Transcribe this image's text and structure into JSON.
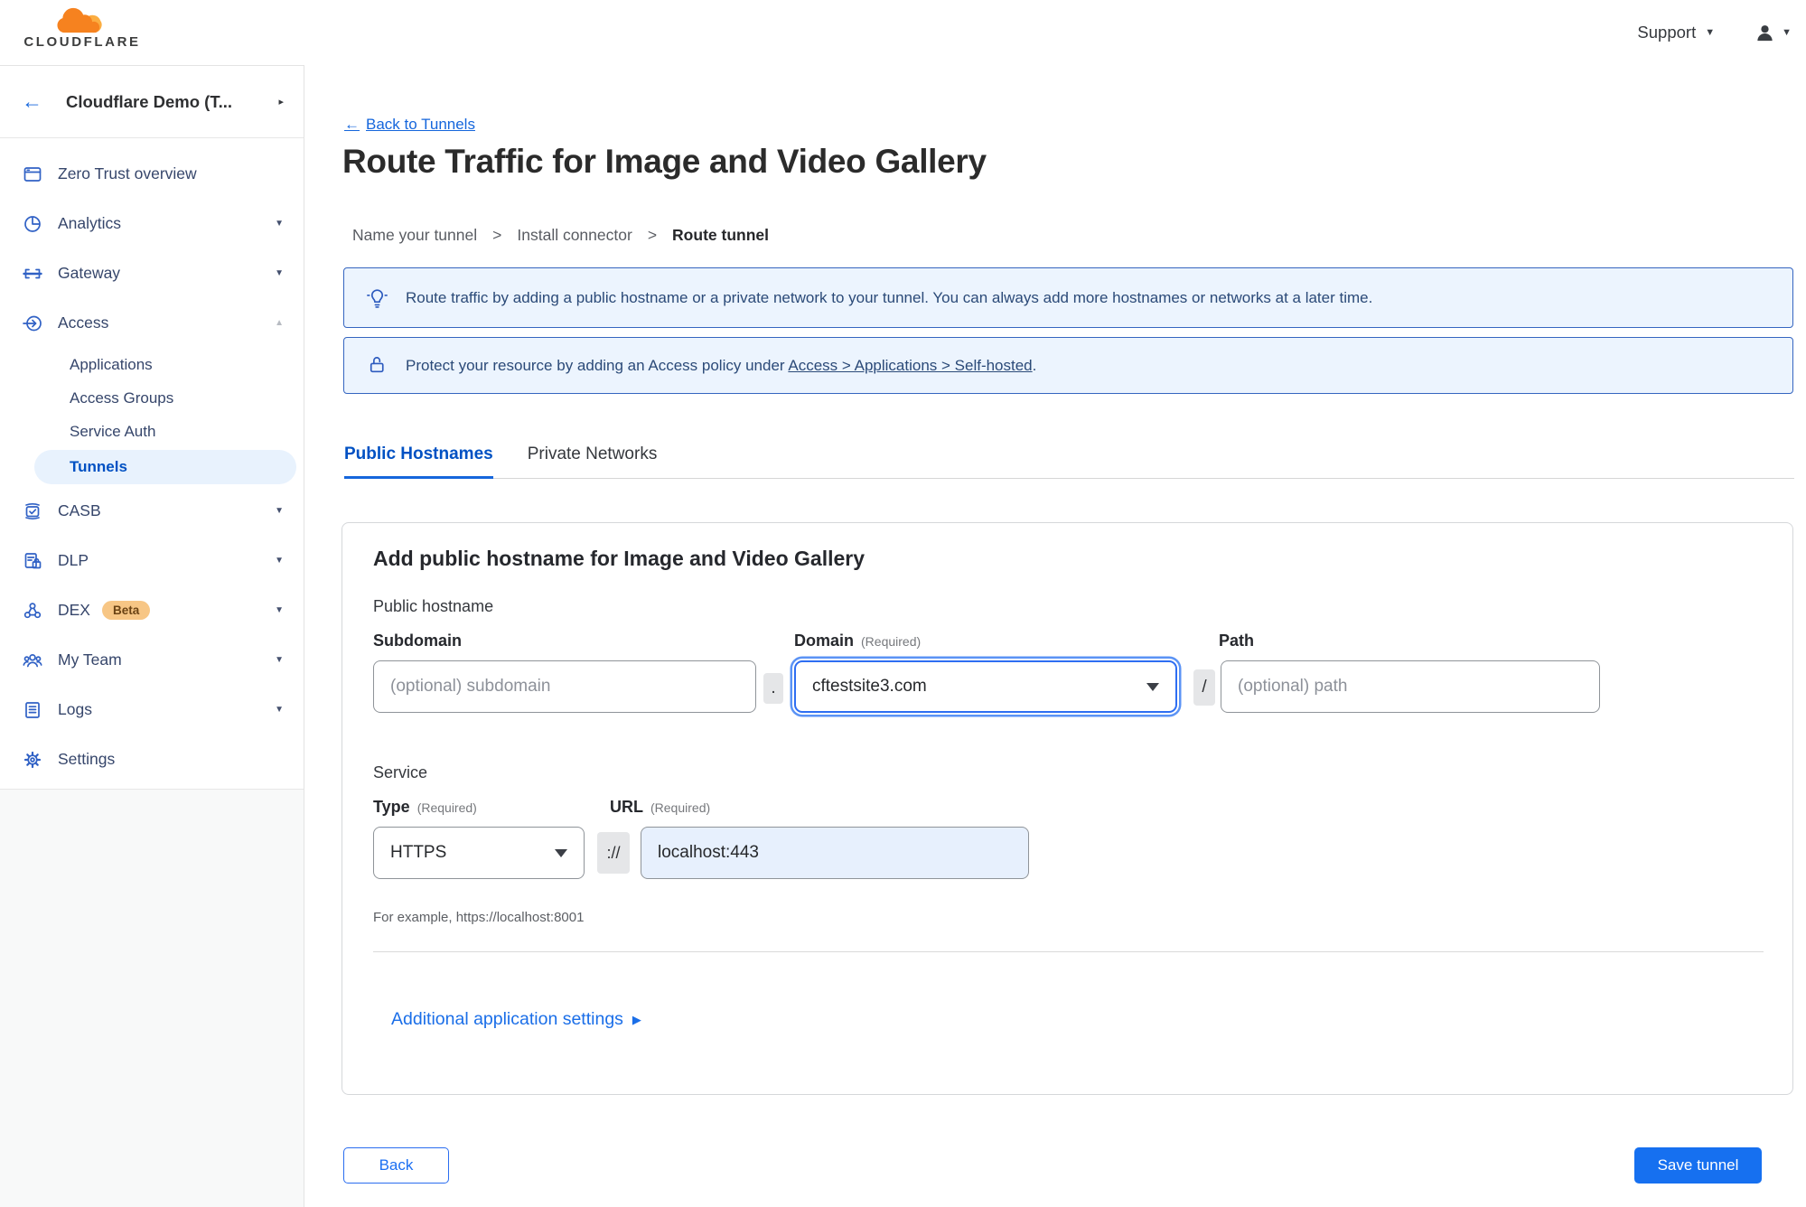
{
  "topbar": {
    "logo_text": "CLOUDFLARE",
    "support_label": "Support"
  },
  "sidebar": {
    "account_name": "Cloudflare Demo (T...",
    "items": [
      {
        "label": "Zero Trust overview"
      },
      {
        "label": "Analytics"
      },
      {
        "label": "Gateway"
      },
      {
        "label": "Access"
      },
      {
        "label": "CASB"
      },
      {
        "label": "DLP"
      },
      {
        "label": "DEX",
        "badge": "Beta"
      },
      {
        "label": "My Team"
      },
      {
        "label": "Logs"
      },
      {
        "label": "Settings"
      }
    ],
    "access_children": [
      {
        "label": "Applications"
      },
      {
        "label": "Access Groups"
      },
      {
        "label": "Service Auth"
      },
      {
        "label": "Tunnels"
      }
    ],
    "active_item": "Tunnels"
  },
  "main": {
    "back_link": "Back to Tunnels",
    "title": "Route Traffic for Image and Video Gallery",
    "breadcrumb": {
      "step1": "Name your tunnel",
      "step2": "Install connector",
      "step3": "Route tunnel",
      "separator": ">"
    },
    "banner_info": "Route traffic by adding a public hostname or a private network to your tunnel. You can always add more hostnames or networks at a later time.",
    "banner_protect": {
      "prefix": "Protect your resource by adding an Access policy under",
      "link": "Access > Applications > Self-hosted",
      "suffix": "."
    },
    "tabs": {
      "public": "Public Hostnames",
      "private": "Private Networks"
    },
    "card": {
      "heading": "Add public hostname for Image and Video Gallery",
      "public_hostname_label": "Public hostname",
      "subdomain_label": "Subdomain",
      "domain_label": "Domain",
      "required_label": "(Required)",
      "path_label": "Path",
      "subdomain_placeholder": "(optional) subdomain",
      "domain_value": "cftestsite3.com",
      "path_placeholder": "(optional) path",
      "dot_separator": ".",
      "slash_separator": "/",
      "service_label": "Service",
      "type_label": "Type",
      "url_label": "URL",
      "type_value": "HTTPS",
      "scheme_separator": "://",
      "url_value": "localhost:443",
      "example_hint": "For example, https://localhost:8001",
      "additional_settings_label": "Additional application settings"
    },
    "footer": {
      "back_label": "Back",
      "save_label": "Save tunnel"
    }
  },
  "icons": {
    "chevron_down": "▼",
    "chevron_up": "▲",
    "chevron_right": "▸",
    "dropdown_caret": "▼",
    "back_arrow": "←",
    "forward_caret": "▶"
  },
  "colors": {
    "accent_blue": "#1670f0",
    "link_blue": "#1566dc",
    "active_tab_blue": "#0051c3",
    "banner_border": "#3565c0",
    "banner_bg": "#ecf4fe",
    "active_pill_bg": "#e8f2fd",
    "beta_badge_bg": "#f7c685",
    "url_field_bg": "#e7f0fd",
    "logo_orange": "#F6821F",
    "logo_light_orange": "#FBAD41"
  }
}
